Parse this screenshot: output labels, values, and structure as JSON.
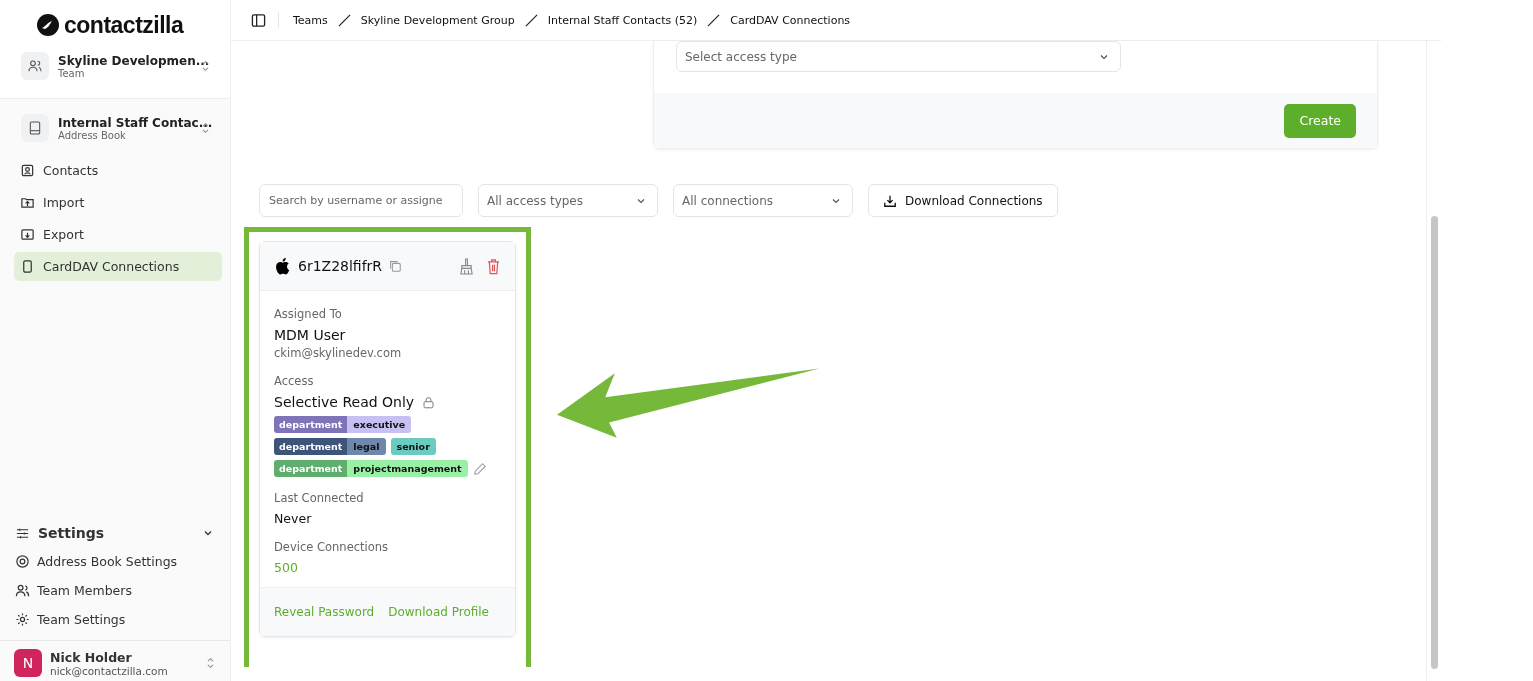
{
  "sidebar": {
    "logo": "contactzilla",
    "team": {
      "name": "Skyline Developmen...",
      "subtitle": "Team"
    },
    "address_book": {
      "name": "Internal Staff Contac...",
      "subtitle": "Address Book"
    },
    "nav": [
      {
        "label": "Contacts",
        "selected": false
      },
      {
        "label": "Import",
        "selected": false
      },
      {
        "label": "Export",
        "selected": false
      },
      {
        "label": "CardDAV Connections",
        "selected": true
      }
    ],
    "settings": {
      "title": "Settings",
      "expanded": true,
      "items": [
        "Address Book Settings",
        "Team Members",
        "Team Settings"
      ]
    },
    "user": {
      "initial": "N",
      "name": "Nick Holder",
      "email": "nick@contactzilla.com"
    }
  },
  "breadcrumbs": [
    "Teams",
    "Skyline Development Group",
    "Internal Staff Contacts (52)",
    "CardDAV Connections"
  ],
  "create_form": {
    "access_select": {
      "placeholder": "Select access type"
    },
    "button": "Create"
  },
  "filters": {
    "search": {
      "placeholder": "Search by username or assigne"
    },
    "access_filter": "All access types",
    "connection_filter": "All connections",
    "download_button": "Download Connections"
  },
  "connections": [
    {
      "username": "6r1Z28lfifrR",
      "assigned_label": "Assigned To",
      "assigned_name": "MDM User",
      "assigned_email": "ckim@skylinedev.com",
      "access_label": "Access",
      "access": "Selective Read Only",
      "locked": true,
      "tag_rows": [
        [
          {
            "parts": [
              {
                "text": "department",
                "color": "#7f74b8"
              },
              {
                "text": "executive",
                "color": "#c7c0f2"
              }
            ]
          }
        ],
        [
          {
            "parts": [
              {
                "text": "department",
                "color": "#3e5478"
              },
              {
                "text": "legal",
                "color": "#6f87a8"
              }
            ]
          },
          {
            "parts": [
              {
                "text": "senior",
                "color": "#6ccbc0"
              }
            ]
          }
        ],
        [
          {
            "parts": [
              {
                "text": "department",
                "color": "#5fae6d"
              },
              {
                "text": "projectmanagement",
                "color": "#9bf0a8"
              }
            ]
          }
        ]
      ],
      "last_connected_label": "Last Connected",
      "last_connected": "Never",
      "devices_label": "Device Connections",
      "devices": "500",
      "actions": [
        "Reveal Password",
        "Download Profile"
      ]
    }
  ]
}
